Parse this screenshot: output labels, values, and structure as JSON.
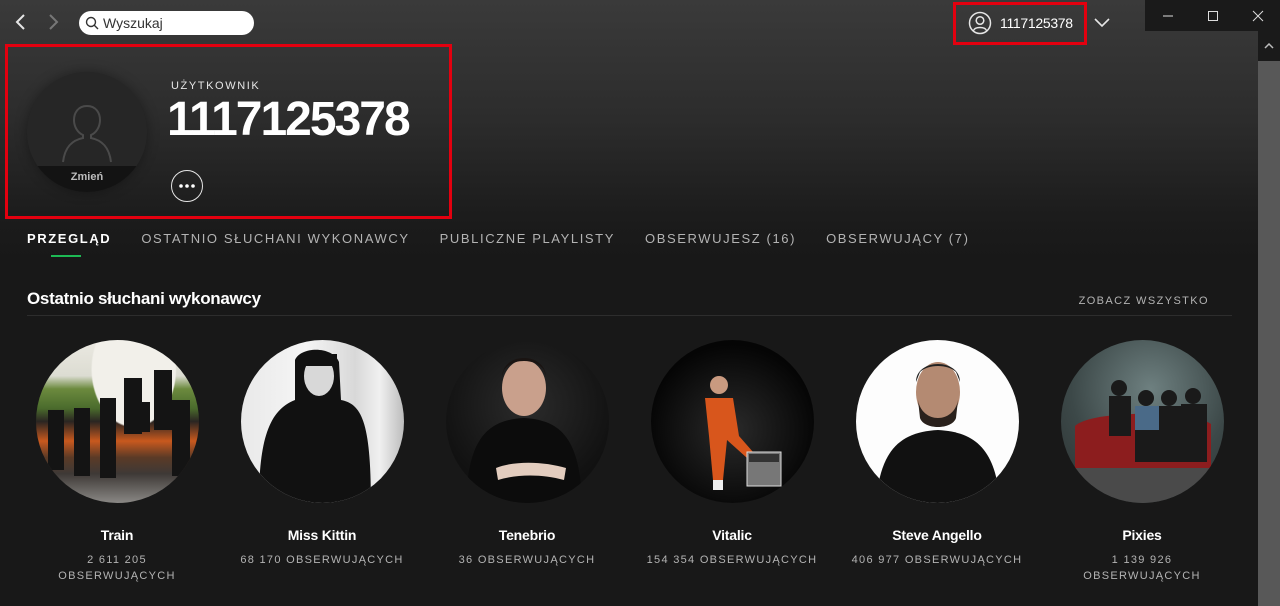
{
  "topbar": {
    "search_placeholder": "Wyszukaj",
    "username": "1117125378"
  },
  "profile": {
    "type_label": "UŻYTKOWNIK",
    "name": "1117125378",
    "change_photo_label": "Zmień"
  },
  "tabs": [
    {
      "label": "PRZEGLĄD",
      "active": true
    },
    {
      "label": "OSTATNIO SŁUCHANI WYKONAWCY",
      "active": false
    },
    {
      "label": "PUBLICZNE PLAYLISTY",
      "active": false
    },
    {
      "label": "OBSERWUJESZ (16)",
      "active": false
    },
    {
      "label": "OBSERWUJĄCY (7)",
      "active": false
    }
  ],
  "section": {
    "title": "Ostatnio słuchani wykonawcy",
    "see_all": "ZOBACZ WSZYSTKO"
  },
  "artists": [
    {
      "name": "Train",
      "followers": "2 611 205 OBSERWUJĄCYCH"
    },
    {
      "name": "Miss Kittin",
      "followers": "68 170 OBSERWUJĄCYCH"
    },
    {
      "name": "Tenebrio",
      "followers": "36 OBSERWUJĄCYCH"
    },
    {
      "name": "Vitalic",
      "followers": "154 354 OBSERWUJĄCYCH"
    },
    {
      "name": "Steve Angello",
      "followers": "406 977 OBSERWUJĄCYCH"
    },
    {
      "name": "Pixies",
      "followers": "1 139 926 OBSERWUJĄCYCH"
    }
  ],
  "colors": {
    "accent_green": "#1db954",
    "highlight_red": "#e3000f",
    "background": "#181818"
  }
}
